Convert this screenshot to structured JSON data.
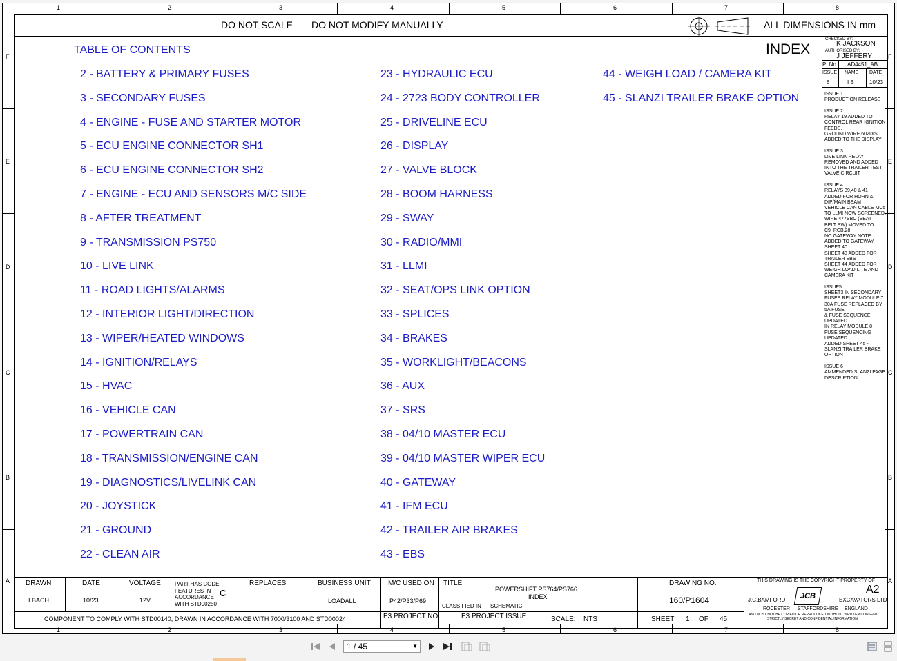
{
  "header": {
    "do_not_scale": "DO NOT SCALE",
    "do_not_modify": "DO NOT MODIFY MANUALLY",
    "all_dimensions": "ALL DIMENSIONS IN mm"
  },
  "zones": {
    "columns": [
      "1",
      "2",
      "3",
      "4",
      "5",
      "6",
      "7",
      "8"
    ],
    "rows": [
      "F",
      "E",
      "D",
      "C",
      "B",
      "A"
    ]
  },
  "toc": {
    "heading": "TABLE OF CONTENTS",
    "index_title": "INDEX",
    "col1": [
      "2 - BATTERY & PRIMARY FUSES",
      "3 - SECONDARY FUSES",
      "4 - ENGINE - FUSE AND STARTER MOTOR",
      "5 - ECU ENGINE CONNECTOR SH1",
      "6 - ECU ENGINE CONNECTOR SH2",
      "7 - ENGINE - ECU AND SENSORS M/C SIDE",
      "8 - AFTER TREATMENT",
      "9 - TRANSMISSION PS750",
      "10 - LIVE LINK",
      "11 - ROAD LIGHTS/ALARMS",
      "12 - INTERIOR LIGHT/DIRECTION",
      "13 - WIPER/HEATED WINDOWS",
      "14 - IGNITION/RELAYS",
      "15 - HVAC",
      "16 - VEHICLE CAN",
      "17 - POWERTRAIN CAN",
      "18 - TRANSMISSION/ENGINE CAN",
      "19 - DIAGNOSTICS/LIVELINK CAN",
      "20 - JOYSTICK",
      "21 - GROUND",
      "22 - CLEAN AIR"
    ],
    "col2": [
      "23 - HYDRAULIC ECU",
      "24 - 2723 BODY CONTROLLER",
      "25 - DRIVELINE ECU",
      "26 - DISPLAY",
      "27 - VALVE BLOCK",
      "28 - BOOM HARNESS",
      "29 - SWAY",
      "30 - RADIO/MMI",
      "31 - LLMI",
      "32 - SEAT/OPS LINK OPTION",
      "33 - SPLICES",
      "34 - BRAKES",
      "35 - WORKLIGHT/BEACONS",
      "36 - AUX",
      "37 - SRS",
      "38 - 04/10 MASTER ECU",
      "39 - 04/10 MASTER WIPER ECU",
      "40 - GATEWAY",
      "41 - IFM ECU",
      "42 - TRAILER AIR BRAKES",
      "43 - EBS"
    ],
    "col3": [
      "44 - WEIGH LOAD / CAMERA KIT",
      "45 - SLANZI TRAILER BRAKE OPTION"
    ]
  },
  "revision": {
    "checked_by_label": "CHECKED BY:",
    "checked_by": "K JACKSON",
    "authorised_by_label": "AUTHORISED BY:",
    "authorised_by": "J JEFFERY",
    "pi_no_label": "PI No",
    "pi_no": "AD4451_AB",
    "issue_label": "ISSUE",
    "name_label": "NAME",
    "date_label": "DATE",
    "issue": "6",
    "name": "I B",
    "date": "10/23",
    "notes": [
      {
        "title": "ISSUE 1",
        "lines": [
          "PRODUCTION RELEASE"
        ]
      },
      {
        "title": "ISSUE 2",
        "lines": [
          "RELAY 19 ADDED TO",
          "CONTROL REAR IGNITION",
          "FEEDS,",
          "GROUND WIRE 602DIS",
          "ADDED TO THE DISPLAY"
        ]
      },
      {
        "title": "ISSUE 3",
        "lines": [
          "LIVE LINK RELAY",
          "REMOVED AND ADDED",
          "INTO THE TRAILER TEST",
          "VALVE CIRCUIT"
        ]
      },
      {
        "title": "ISSUE 4",
        "lines": [
          "RELAYS 39,40 & 41",
          "ADDED FOR HORN &",
          "DIP/MAIN BEAM",
          "VEHICLE CAN CABLE MC5",
          "TO LLMI NOW SCREENED.",
          "WIRE 477SBC (SEAT",
          "BELT SW) MOVED TO",
          "C9_RCB.28.",
          "NO GATEWAY NOTE",
          "ADDED TO GATEWAY",
          "SHEET 40.",
          "SHEET 43 ADDED FOR",
          "TRAILER EBS",
          "SHEET 44 ADDED FOR",
          "WEIGH LOAD LITE AND",
          "CAMERA KIT"
        ]
      },
      {
        "title": "ISSUE5",
        "lines": [
          "SHEET3 IN SECONDARY",
          "FUSES RELAY MODULE 7",
          "30A FUSE REPLACED BY",
          "5A FUSE",
          "& FUSE SEQUENCE",
          "UPDATED.",
          "IN RELAY MODULE 8",
          "FUSE SEQUENCING",
          "UPDATED.",
          "ADDED SHEET 45 -",
          "SLANZI TRAILER BRAKE",
          "OPTION"
        ]
      },
      {
        "title": "ISSUE 6",
        "lines": [
          "AMMENDED SLANZI PAGE",
          "DESCRIPTION"
        ]
      }
    ]
  },
  "title_block": {
    "drawn_label": "DRAWN",
    "drawn": "I BACH",
    "date_label": "DATE",
    "date": "10/23",
    "voltage_label": "VOLTAGE",
    "voltage": "12V",
    "part_code_lines": [
      "PART HAS CODE",
      "FEATURES IN",
      "ACCORDANCE",
      "WITH STD00250"
    ],
    "part_code_value": "C",
    "replaces_label": "REPLACES",
    "business_unit_label": "BUSINESS UNIT",
    "business_unit": "LOADALL",
    "mc_used_on_label": "M/C USED ON",
    "mc_used_on": "P42/P33/P69",
    "title_label": "TITLE",
    "title_line1": "POWERSHIFT PS764/PS766",
    "title_line2": "INDEX",
    "classified_in_label": "CLASSIFIED IN",
    "classified_in": "SCHEMATIC",
    "drawing_no_label": "DRAWING NO.",
    "drawing_no": "160/P1604",
    "comply_note": "COMPONENT TO COMPLY WITH STD00140, DRAWN IN ACCORDANCE WITH 7000/3100 AND STD00024",
    "e3_project_no_label": "E3 PROJECT NO.",
    "e3_project_issue_label": "E3 PROJECT ISSUE",
    "scale_label": "SCALE:",
    "scale": "NTS",
    "sheet_label": "SHEET",
    "sheet": "1",
    "of_label": "OF",
    "sheet_total": "45",
    "copyright_line": "THIS DRAWING IS THE COPYRIGHT PROPERTY OF",
    "paper_size": "A2",
    "company_left": "J.C.BAMFORD",
    "company_right": "EXCAVATORS LTD",
    "logo_text": "JCB",
    "loc1": "ROCESTER",
    "loc2": "STAFFORDSHIRE",
    "loc3": "ENGLAND",
    "confidential1": "AND MUST NOT BE COPIED OR REPRODUCED WITHOUT WRITTEN CONSENT.",
    "confidential2": "STRICTLY SECRET AND CONFIDENTIAL INFORMATION"
  },
  "viewer": {
    "page_value": "1 / 45"
  }
}
